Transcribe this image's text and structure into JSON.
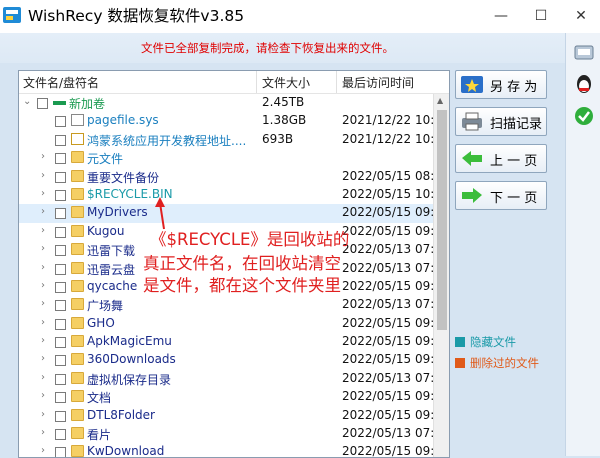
{
  "window": {
    "title": "WishRecy 数据恢复软件v3.85",
    "minimize": "—",
    "restore": "☐",
    "close": "✕"
  },
  "status_message": "文件已全部复制完成，请检查下恢复出来的文件。",
  "columns": {
    "name": "文件名/盘符名",
    "size": "文件大小",
    "date": "最后访问时间"
  },
  "rows": [
    {
      "chev": "⌄",
      "name": "新加卷",
      "size": "2.45TB",
      "date": "",
      "type": "drive",
      "color": "#1a9a50"
    },
    {
      "chev": "",
      "name": "pagefile.sys",
      "size": "1.38GB",
      "date": "2021/12/22 10:0",
      "type": "file",
      "color": "#1a7fbf"
    },
    {
      "chev": "",
      "name": "鸿蒙系统应用开发教程地址....",
      "size": "693B",
      "date": "2021/12/22 10:0",
      "type": "txt",
      "color": "#1a7fbf"
    },
    {
      "chev": "›",
      "name": "元文件",
      "size": "",
      "date": "",
      "type": "folder",
      "color": "#1a7fbf"
    },
    {
      "chev": "›",
      "name": "重要文件备份",
      "size": "",
      "date": "2022/05/15 08:5",
      "type": "folder",
      "color": "#1a2b8a"
    },
    {
      "chev": "›",
      "name": "$RECYCLE.BIN",
      "size": "",
      "date": "2022/05/15 10:2",
      "type": "folder",
      "color": "#1a9aa8"
    },
    {
      "chev": "›",
      "name": "MyDrivers",
      "size": "",
      "date": "2022/05/15 09:1",
      "type": "folder",
      "color": "#1a2b8a"
    },
    {
      "chev": "›",
      "name": "Kugou",
      "size": "",
      "date": "2022/05/15 09:1",
      "type": "folder",
      "color": "#1a2b8a"
    },
    {
      "chev": "›",
      "name": "迅雷下载",
      "size": "",
      "date": "2022/05/13 07:3",
      "type": "folder",
      "color": "#1a2b8a"
    },
    {
      "chev": "›",
      "name": "迅雷云盘",
      "size": "",
      "date": "2022/05/13 07:3",
      "type": "folder",
      "color": "#1a2b8a"
    },
    {
      "chev": "›",
      "name": "qycache",
      "size": "",
      "date": "2022/05/15 09:1",
      "type": "folder",
      "color": "#1a2b8a"
    },
    {
      "chev": "›",
      "name": "广场舞",
      "size": "",
      "date": "2022/05/13 07:3",
      "type": "folder",
      "color": "#1a2b8a"
    },
    {
      "chev": "›",
      "name": "GHO",
      "size": "",
      "date": "2022/05/15 09:1",
      "type": "folder",
      "color": "#1a2b8a"
    },
    {
      "chev": "›",
      "name": "ApkMagicEmu",
      "size": "",
      "date": "2022/05/15 09:1",
      "type": "folder",
      "color": "#1a2b8a"
    },
    {
      "chev": "›",
      "name": "360Downloads",
      "size": "",
      "date": "2022/05/15 09:1",
      "type": "folder",
      "color": "#1a2b8a"
    },
    {
      "chev": "›",
      "name": "虚拟机保存目录",
      "size": "",
      "date": "2022/05/13 07:3",
      "type": "folder",
      "color": "#1a2b8a"
    },
    {
      "chev": "›",
      "name": "文档",
      "size": "",
      "date": "2022/05/15 09:1",
      "type": "folder",
      "color": "#1a2b8a"
    },
    {
      "chev": "›",
      "name": "DTL8Folder",
      "size": "",
      "date": "2022/05/15 09:1",
      "type": "folder",
      "color": "#1a2b8a"
    },
    {
      "chev": "›",
      "name": "看片",
      "size": "",
      "date": "2022/05/13 07:3",
      "type": "folder",
      "color": "#1a2b8a"
    },
    {
      "chev": "›",
      "name": "KwDownload",
      "size": "",
      "date": "2022/05/15 09:1",
      "type": "folder",
      "color": "#1a2b8a"
    }
  ],
  "buttons": {
    "save_as": "另 存 为",
    "scan_log": "扫描记录",
    "prev_page": "上 一 页",
    "next_page": "下 一 页"
  },
  "legend": {
    "hidden": {
      "label": "隐藏文件",
      "color": "#1a9aa8"
    },
    "deleted": {
      "label": "删除过的文件",
      "color": "#e05a1a"
    }
  },
  "annotation": {
    "line1": "《$RECYCLE》是回收站的",
    "line2": "真正文件名，在回收站清空",
    "line3": "是文件，都在这个文件夹里"
  },
  "side_icons": [
    "settings-icon",
    "qq-icon",
    "check-icon"
  ]
}
